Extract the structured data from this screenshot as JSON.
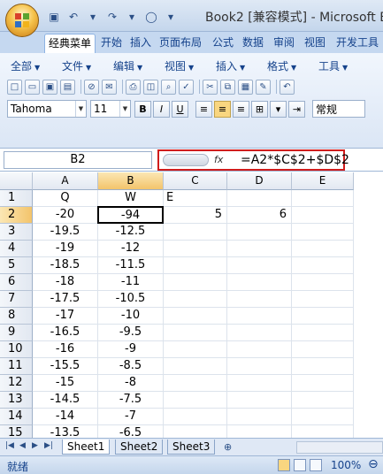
{
  "window": {
    "title": "Book2 [兼容模式] - Microsoft Ex"
  },
  "qat": [
    {
      "name": "save-icon",
      "glyph": "▣"
    },
    {
      "name": "undo-icon",
      "glyph": "↶"
    },
    {
      "name": "undo-dropdown-icon",
      "glyph": "▾"
    },
    {
      "name": "redo-icon",
      "glyph": "↷"
    },
    {
      "name": "redo-dropdown-icon",
      "glyph": "▾"
    },
    {
      "name": "circle-icon",
      "glyph": "◯"
    },
    {
      "name": "customize-qat-icon",
      "glyph": "▾"
    }
  ],
  "tabs": [
    {
      "label": "经典菜单",
      "name": "tab-classic-menu",
      "active": true
    },
    {
      "label": "开始",
      "name": "tab-home"
    },
    {
      "label": "插入",
      "name": "tab-insert"
    },
    {
      "label": "页面布局",
      "name": "tab-page-layout"
    },
    {
      "label": "公式",
      "name": "tab-formulas"
    },
    {
      "label": "数据",
      "name": "tab-data"
    },
    {
      "label": "审阅",
      "name": "tab-review"
    },
    {
      "label": "视图",
      "name": "tab-view"
    },
    {
      "label": "开发工具",
      "name": "tab-developer"
    }
  ],
  "menu": [
    {
      "label": "全部",
      "name": "menu-all"
    },
    {
      "label": "文件",
      "name": "menu-file"
    },
    {
      "label": "编辑",
      "name": "menu-edit"
    },
    {
      "label": "视图",
      "name": "menu-view"
    },
    {
      "label": "插入",
      "name": "menu-insert"
    },
    {
      "label": "格式",
      "name": "menu-format"
    },
    {
      "label": "工具",
      "name": "menu-tools"
    }
  ],
  "toolbar": [
    {
      "name": "new-icon",
      "glyph": "□"
    },
    {
      "name": "open-icon",
      "glyph": "▭"
    },
    {
      "name": "save-disk-icon",
      "glyph": "▣"
    },
    {
      "name": "save-as-icon",
      "glyph": "▤"
    },
    {
      "sep": true
    },
    {
      "name": "permission-icon",
      "glyph": "⊘"
    },
    {
      "name": "email-icon",
      "glyph": "✉"
    },
    {
      "sep": true
    },
    {
      "name": "print-icon",
      "glyph": "⎙"
    },
    {
      "name": "print-preview-icon",
      "glyph": "◫"
    },
    {
      "name": "research-icon",
      "glyph": "⌕"
    },
    {
      "name": "spelling-icon",
      "glyph": "✓"
    },
    {
      "sep": true
    },
    {
      "name": "cut-icon",
      "glyph": "✂"
    },
    {
      "name": "copy-icon",
      "glyph": "⧉"
    },
    {
      "name": "paste-icon",
      "glyph": "▦"
    },
    {
      "name": "format-painter-icon",
      "glyph": "✎"
    },
    {
      "sep": true
    },
    {
      "name": "undo-toolbar-icon",
      "glyph": "↶"
    }
  ],
  "font": {
    "name": "Tahoma",
    "size": "11"
  },
  "format_buttons": [
    {
      "label": "B",
      "name": "bold-button"
    },
    {
      "label": "I",
      "name": "italic-button"
    },
    {
      "label": "U",
      "name": "underline-button"
    }
  ],
  "align_buttons": [
    {
      "name": "align-left-icon",
      "glyph": "≡"
    },
    {
      "name": "align-center-icon",
      "glyph": "≡",
      "on": true
    },
    {
      "name": "align-right-icon",
      "glyph": "≡"
    },
    {
      "name": "merge-center-icon",
      "glyph": "⊞"
    },
    {
      "name": "wrap-icon",
      "glyph": "▾"
    },
    {
      "name": "indent-icon",
      "glyph": "⇥"
    }
  ],
  "number_format": {
    "value": "常规"
  },
  "formula_bar": {
    "name_box": "B2",
    "fx": "fx",
    "formula": "=A2*$C$2+$D$2"
  },
  "sheet": {
    "columns": [
      "A",
      "B",
      "C",
      "D",
      "E"
    ],
    "rows": [
      {
        "n": "1",
        "a": "Q",
        "b": "W",
        "e_left": "E"
      },
      {
        "n": "2",
        "a": "-20",
        "b": "-94",
        "c": "5",
        "d": "6"
      },
      {
        "n": "3",
        "a": "-19.5",
        "b": "-12.5"
      },
      {
        "n": "4",
        "a": "-19",
        "b": "-12"
      },
      {
        "n": "5",
        "a": "-18.5",
        "b": "-11.5"
      },
      {
        "n": "6",
        "a": "-18",
        "b": "-11"
      },
      {
        "n": "7",
        "a": "-17.5",
        "b": "-10.5"
      },
      {
        "n": "8",
        "a": "-17",
        "b": "-10"
      },
      {
        "n": "9",
        "a": "-16.5",
        "b": "-9.5"
      },
      {
        "n": "10",
        "a": "-16",
        "b": "-9"
      },
      {
        "n": "11",
        "a": "-15.5",
        "b": "-8.5"
      },
      {
        "n": "12",
        "a": "-15",
        "b": "-8"
      },
      {
        "n": "13",
        "a": "-14.5",
        "b": "-7.5"
      },
      {
        "n": "14",
        "a": "-14",
        "b": "-7"
      },
      {
        "n": "15",
        "a": "-13.5",
        "b": "-6.5"
      }
    ]
  },
  "sheet_tabs": [
    "Sheet1",
    "Sheet2",
    "Sheet3"
  ],
  "status": {
    "text": "就绪",
    "zoom": "100%",
    "zoom_out": "⊖"
  }
}
